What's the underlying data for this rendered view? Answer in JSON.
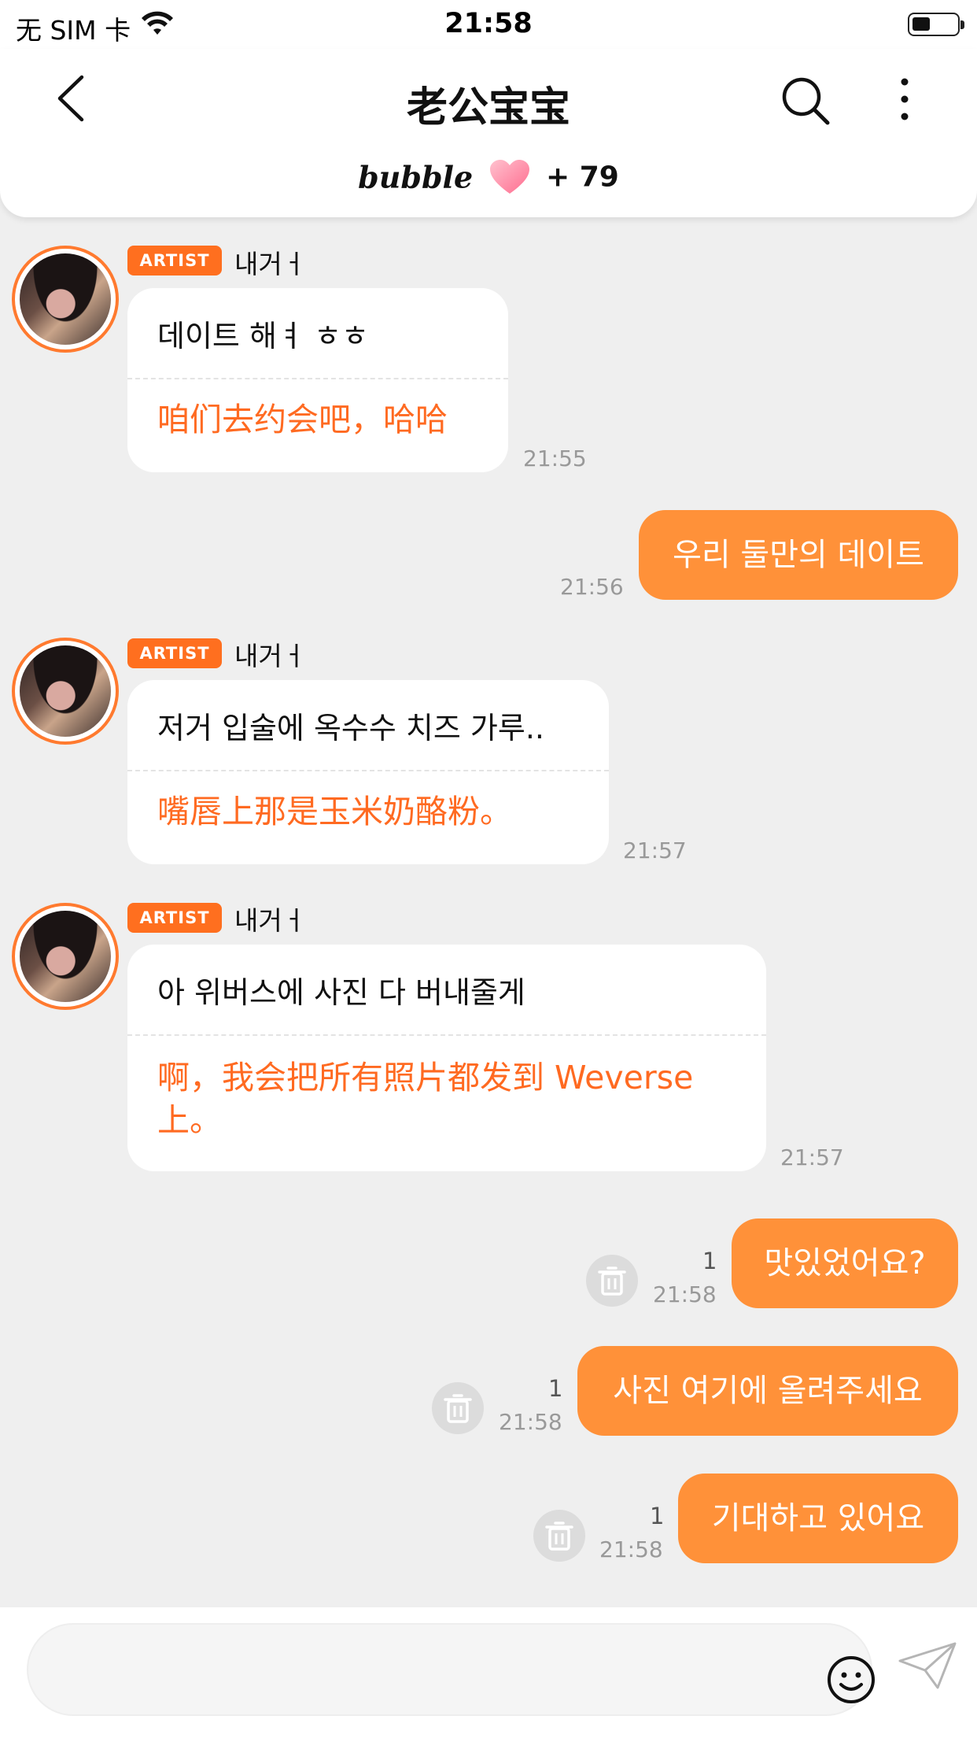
{
  "status_bar": {
    "carrier": "无 SIM 卡",
    "time": "21:58"
  },
  "header": {
    "title": "老公宝宝",
    "brand": "bubble",
    "plus_count": "+ 79"
  },
  "messages": [
    {
      "sender": "artist",
      "badge": "ARTIST",
      "name": "내거ㅓ",
      "korean": "데이트 해ㅕ ㅎㅎ",
      "translation": "咱们去约会吧，哈哈",
      "time": "21:55"
    },
    {
      "sender": "user",
      "text": "우리 둘만의 데이트",
      "time": "21:56"
    },
    {
      "sender": "artist",
      "badge": "ARTIST",
      "name": "내거ㅓ",
      "korean": "저거 입술에 옥수수 치즈 가루..",
      "translation": "嘴唇上那是玉米奶酪粉。",
      "time": "21:57"
    },
    {
      "sender": "artist",
      "badge": "ARTIST",
      "name": "내거ㅓ",
      "korean": "아 위버스에 사진 다 버내줄게",
      "translation": "啊，我会把所有照片都发到 Weverse 上。",
      "time": "21:57"
    },
    {
      "sender": "user",
      "text": "맛있었어요?",
      "time": "21:58",
      "unread": "1"
    },
    {
      "sender": "user",
      "text": "사진 여기에 올려주세요",
      "time": "21:58",
      "unread": "1"
    },
    {
      "sender": "user",
      "text": "기대하고 있어요",
      "time": "21:58",
      "unread": "1"
    }
  ],
  "input": {
    "placeholder": ""
  },
  "colors": {
    "accent": "#ff6f1f",
    "user_bubble": "#ff9139",
    "translation_text": "#ff6a21",
    "background": "#efefef"
  }
}
